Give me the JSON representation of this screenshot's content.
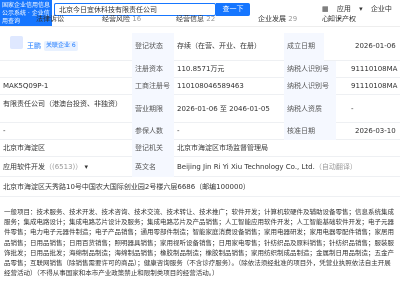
{
  "header": {
    "logo_text": "国家企业信用信息公示系统 · 企业信用查询",
    "search_value": "北京今日宜休科技有限责任公司",
    "search_button": "查一下",
    "app_label": "应用",
    "menu_label": "企业中心"
  },
  "tabs": [
    {
      "label": "法律诉讼",
      "count": ""
    },
    {
      "label": "经营风险",
      "count": "16"
    },
    {
      "label": "经营信息",
      "count": "22"
    },
    {
      "label": "企业发展",
      "count": "29"
    },
    {
      "label": "知识产权",
      "count": ""
    }
  ],
  "legal_rep": {
    "name": "王鹏",
    "badge": "关联企业 6"
  },
  "rows": {
    "status_label": "登记状态",
    "status_value": "存续（在营、开业、在册）",
    "established_label": "成立日期",
    "established_value": "2026-01-06",
    "capital_label": "注册资本",
    "capital_value": "110.8571万元",
    "taxid_label": "纳税人识别号",
    "taxid_value": "91110108MA",
    "code_prefix": "MAK5Q09P-1",
    "regno_label": "工商注册号",
    "regno_value": "110108046589463",
    "taxid2_label": "纳税人识别号",
    "taxid2_value": "91110108MA",
    "type_value": "有限责任公司（港澳台投资、非独资）",
    "term_label": "营业期限",
    "term_value": "2026-01-06 至 2046-01-05",
    "taxpayer_label": "纳税人资质",
    "taxpayer_value": "-",
    "insured_label": "参保人数",
    "insured_value": "-",
    "approval_label": "核准日期",
    "approval_value": "2026-03-10",
    "region_value": "北京市海淀区",
    "authority_label": "登记机关",
    "authority_value": "北京市海淀区市场监督管理局",
    "app_software_label": "应用软件开发",
    "app_software_rank": "（(6513)）",
    "en_label": "英文名",
    "en_value": "Beijing Jin Ri Yi Xiu Technology Co., Ltd.",
    "en_note": "（自动翻译）"
  },
  "address": "北京市海淀区天秀路10号中国农大国际创业园2号楼六层6686（邮编100000）",
  "scope": "一般项目：技术服务、技术开发、技术咨询、技术交流、技术转让、技术推广；软件开发；计算机软硬件及辅助设备零售；信息系统集成服务；集成电路设计；集成电路芯片设计及服务；集成电路芯片及产品销售；人工智能应用软件开发；人工智能基础软件开发；电子元器件零售；电力电子元器件制造；电子产品销售；通用零部件制造；智能家庭消费设备销售；家用电器研发；家用电器零配件销售；家居用品销售；日用品销售；日用百货销售；照明器具销售；家用视听设备销售；日用家电零售；针纺织品及原料销售；针纺织品销售；服装服饰批发；日用品批发；海绵制品制造；海绵制品销售；橡胶制品制造；橡胶制品销售；家用纺织制成品制造；金属制日用品制造；五金产品零售；互联网销售（除销售需要许可的商品）；健康咨询服务（不含诊疗服务）。（除依法须经批准的项目外，凭营业执照依法自主开展经营活动）（不得从事国家和本市产业政策禁止和限制类项目的经营活动。）"
}
